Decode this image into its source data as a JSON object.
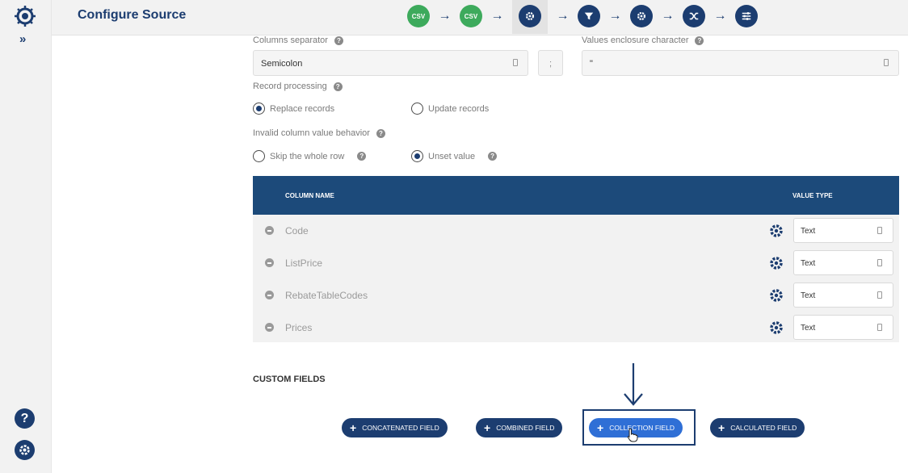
{
  "header": {
    "title": "Configure Source",
    "steps": [
      {
        "kind": "csv",
        "label": "CSV"
      },
      {
        "kind": "csv",
        "label": "CSV"
      },
      {
        "kind": "gear-icon"
      },
      {
        "kind": "filter-icon"
      },
      {
        "kind": "gear-icon"
      },
      {
        "kind": "shuffle-icon"
      },
      {
        "kind": "sliders-icon"
      }
    ]
  },
  "form": {
    "columns_separator_label": "Columns separator",
    "columns_separator_value": "Semicolon",
    "separator_char": ";",
    "enclosure_label": "Values enclosure character",
    "enclosure_value": "\"",
    "record_processing_label": "Record processing",
    "replace_records": "Replace records",
    "update_records": "Update records",
    "invalid_label": "Invalid column value behavior",
    "skip_row": "Skip the whole row",
    "unset_value": "Unset value"
  },
  "table": {
    "headers": {
      "column_name": "COLUMN NAME",
      "value_type": "VALUE TYPE"
    },
    "rows": [
      {
        "name": "Code",
        "type": "Text"
      },
      {
        "name": "ListPrice",
        "type": "Text"
      },
      {
        "name": "RebateTableCodes",
        "type": "Text"
      },
      {
        "name": "Prices",
        "type": "Text"
      }
    ]
  },
  "custom_fields": {
    "title": "CUSTOM FIELDS",
    "buttons": {
      "concatenated": "CONCATENATED FIELD",
      "combined": "COMBINED FIELD",
      "collection": "COLLECTION FIELD",
      "calculated": "CALCULATED FIELD"
    }
  },
  "rail": {
    "expand": "»",
    "help": "?"
  },
  "colors": {
    "brand": "#1c3d70",
    "csv": "#3daa5c",
    "highlight": "#2f6fd6"
  }
}
